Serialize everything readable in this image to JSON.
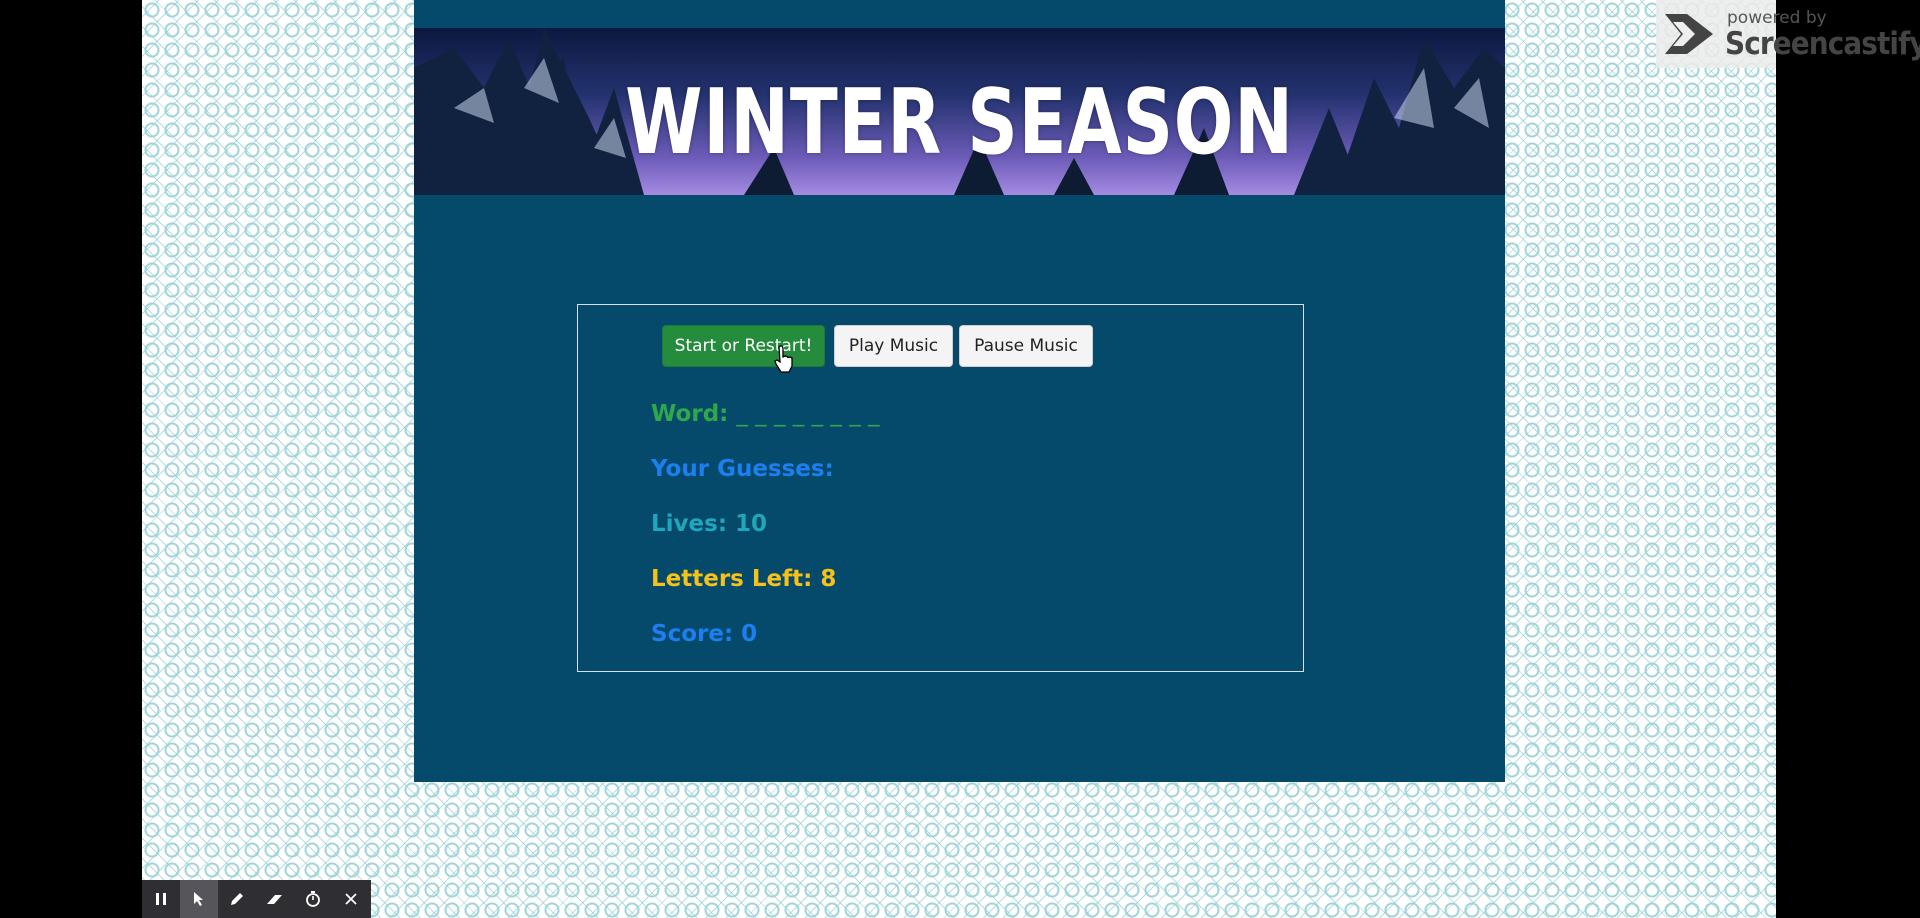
{
  "banner": {
    "title": "WINTER SEASON"
  },
  "controls": {
    "start_label": "Start or Restart!",
    "play_label": "Play Music",
    "pause_label": "Pause Music"
  },
  "game": {
    "word_label": "Word:",
    "word_value": "_ _ _ _ _ _ _ _",
    "guesses_label": "Your Guesses:",
    "guesses_value": "",
    "lives_label": "Lives:",
    "lives_value": "10",
    "letters_left_label": "Letters Left:",
    "letters_left_value": "8",
    "score_label": "Score:",
    "score_value": "0"
  },
  "watermark": {
    "small": "powered by",
    "brand": "Screencastify"
  },
  "toolbar": {
    "tools": [
      "pause-icon",
      "pointer-icon",
      "pen-icon",
      "eraser-icon",
      "timer-icon",
      "close-icon"
    ]
  },
  "colors": {
    "panel": "#054a6a",
    "start_button": "#248c3c",
    "word": "#2ea84a",
    "guesses": "#1b7ff0",
    "lives": "#1fa6bc",
    "letters_left": "#f5c21b",
    "score": "#1b7ff0"
  }
}
